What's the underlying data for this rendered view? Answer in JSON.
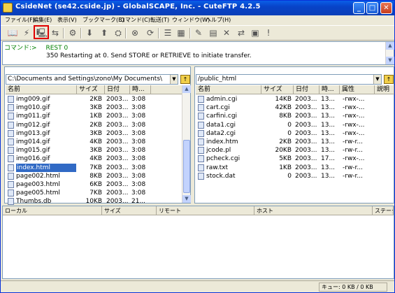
{
  "window": {
    "title": "CsideNet (se42.cside.jp) - GlobalSCAPE, Inc. - CuteFTP 4.2.5"
  },
  "menu": [
    "ファイル(F)",
    "編集(E)",
    "表示(V)",
    "ブックマーク(B)",
    "コマンド(C)",
    "転送(T)",
    "ウィンドウ(W)",
    "ヘルプ(H)"
  ],
  "log": {
    "line1_label": "コマンド:>",
    "line1_cmd": "REST 0",
    "line2": "350 Restarting at 0. Send STORE or RETRIEVE to initiate transfer."
  },
  "local": {
    "path": "C:\\Documents and Settings\\zono\\My Documents\\",
    "columns": [
      "名前",
      "サイズ",
      "日付",
      "時..."
    ],
    "files": [
      {
        "name": "img009.gif",
        "size": "2KB",
        "date": "2003...",
        "time": "3:08"
      },
      {
        "name": "img010.gif",
        "size": "3KB",
        "date": "2003...",
        "time": "3:08"
      },
      {
        "name": "img011.gif",
        "size": "1KB",
        "date": "2003...",
        "time": "3:08"
      },
      {
        "name": "img012.gif",
        "size": "2KB",
        "date": "2003...",
        "time": "3:08"
      },
      {
        "name": "img013.gif",
        "size": "3KB",
        "date": "2003...",
        "time": "3:08"
      },
      {
        "name": "img014.gif",
        "size": "4KB",
        "date": "2003...",
        "time": "3:08"
      },
      {
        "name": "img015.gif",
        "size": "3KB",
        "date": "2003...",
        "time": "3:08"
      },
      {
        "name": "img016.gif",
        "size": "4KB",
        "date": "2003...",
        "time": "3:08"
      },
      {
        "name": "index.html",
        "size": "7KB",
        "date": "2003...",
        "time": "3:08",
        "selected": true
      },
      {
        "name": "page002.html",
        "size": "8KB",
        "date": "2003...",
        "time": "3:08"
      },
      {
        "name": "page003.html",
        "size": "6KB",
        "date": "2003...",
        "time": "3:08"
      },
      {
        "name": "page005.html",
        "size": "7KB",
        "date": "2003...",
        "time": "3:08"
      },
      {
        "name": "Thumbs.db",
        "size": "10KB",
        "date": "2003...",
        "time": "21..."
      }
    ]
  },
  "remote": {
    "path": "/public_html",
    "columns": [
      "名前",
      "サイズ",
      "日付",
      "時...",
      "属性",
      "説明"
    ],
    "files": [
      {
        "name": "admin.cgi",
        "size": "14KB",
        "date": "2003...",
        "time": "13...",
        "attr": "-rwx-..."
      },
      {
        "name": "cart.cgi",
        "size": "42KB",
        "date": "2003...",
        "time": "13...",
        "attr": "-rwx-..."
      },
      {
        "name": "carfini.cgi",
        "size": "8KB",
        "date": "2003...",
        "time": "13...",
        "attr": "-rwx-..."
      },
      {
        "name": "data1.cgi",
        "size": "0",
        "date": "2003...",
        "time": "13...",
        "attr": "-rwx-..."
      },
      {
        "name": "data2.cgi",
        "size": "0",
        "date": "2003...",
        "time": "13...",
        "attr": "-rwx-..."
      },
      {
        "name": "index.htm",
        "size": "2KB",
        "date": "2003...",
        "time": "13...",
        "attr": "-rw-r..."
      },
      {
        "name": "jcode.pl",
        "size": "20KB",
        "date": "2003...",
        "time": "13...",
        "attr": "-rw-r..."
      },
      {
        "name": "pcheck.cgi",
        "size": "5KB",
        "date": "2003...",
        "time": "17...",
        "attr": "-rwx-..."
      },
      {
        "name": "raw.txt",
        "size": "1KB",
        "date": "2003...",
        "time": "13...",
        "attr": "-rw-r..."
      },
      {
        "name": "stock.dat",
        "size": "0",
        "date": "2003...",
        "time": "13...",
        "attr": "-rw-r..."
      }
    ]
  },
  "queue": {
    "columns": [
      "ローカル",
      "サイズ",
      "リモート",
      "ホスト",
      "ステータス"
    ]
  },
  "status": {
    "queue": "キュー: 0 KB / 0 KB"
  }
}
